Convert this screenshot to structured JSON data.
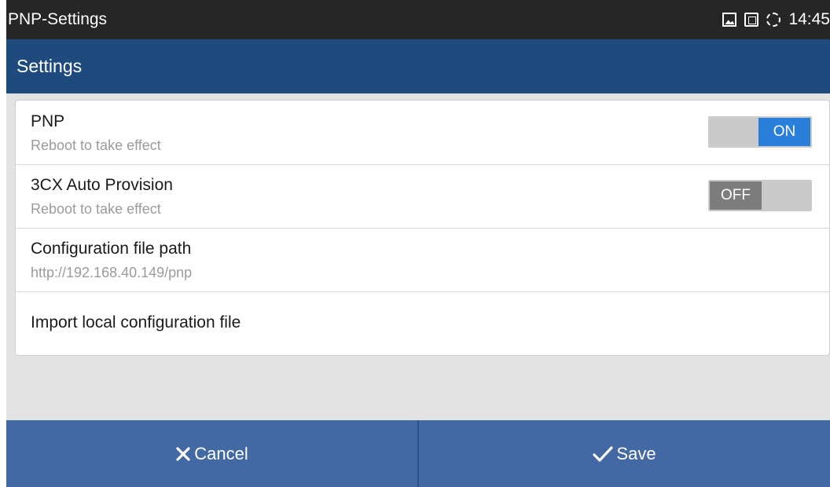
{
  "status_bar": {
    "app_name": "PNP-Settings",
    "time": "14:45",
    "icons": [
      "image-icon",
      "sim-card-icon",
      "sync-icon"
    ]
  },
  "action_bar": {
    "title": "Settings"
  },
  "settings": [
    {
      "title": "PNP",
      "subtitle": "Reboot to take effect",
      "toggle_label": "ON",
      "toggle_state": "on"
    },
    {
      "title": "3CX Auto Provision",
      "subtitle": "Reboot to take effect",
      "toggle_label": "OFF",
      "toggle_state": "off"
    },
    {
      "title": "Configuration file path",
      "subtitle": "http://192.168.40.149/pnp"
    },
    {
      "title": "Import local configuration file"
    }
  ],
  "bottom_bar": {
    "cancel_label": "Cancel",
    "save_label": "Save",
    "cancel_icon": "close-icon",
    "save_icon": "checkmark-icon"
  },
  "colors": {
    "status_bar": "#262626",
    "action_bar": "#1f4a7e",
    "bottom_bar": "#4269a3",
    "toggle_on": "#2a7fdb",
    "toggle_off": "#7d7d7d"
  }
}
